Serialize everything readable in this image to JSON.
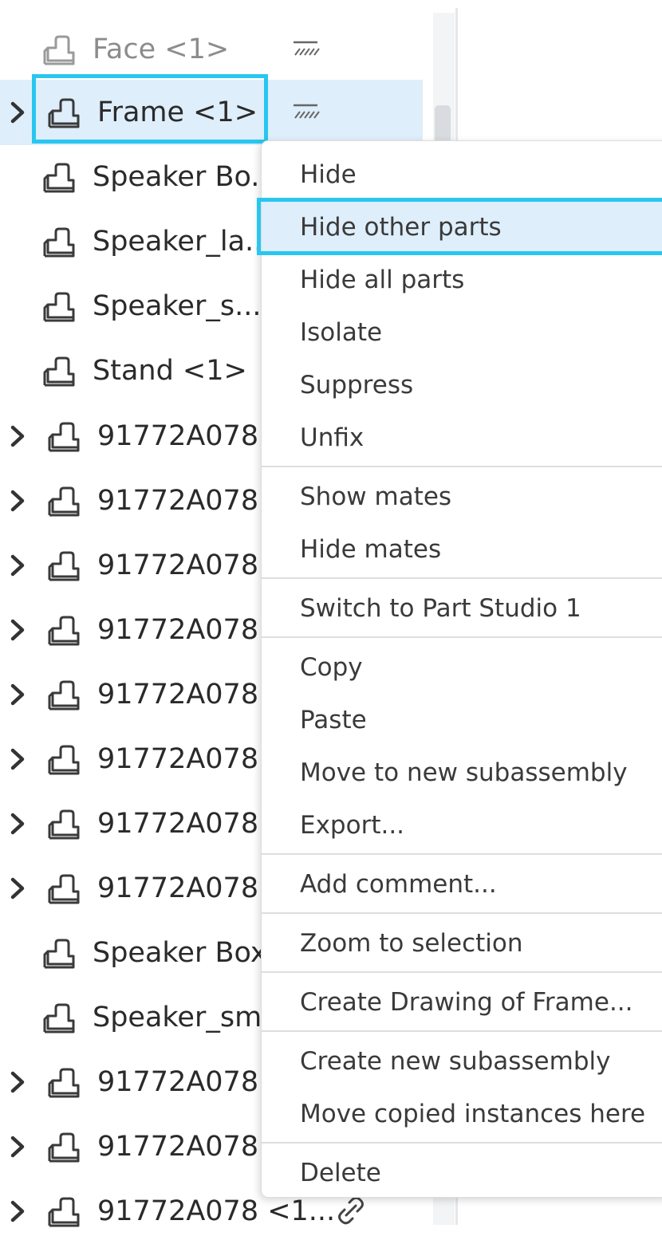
{
  "tree": {
    "rows": [
      {
        "label": "Face <1>"
      },
      {
        "label": "Frame <1>"
      },
      {
        "label": "Speaker Bo..."
      },
      {
        "label": "Speaker_la..."
      },
      {
        "label": "Speaker_s..."
      },
      {
        "label": "Stand <1>"
      },
      {
        "label": "91772A078"
      },
      {
        "label": "91772A078"
      },
      {
        "label": "91772A078"
      },
      {
        "label": "91772A078"
      },
      {
        "label": "91772A078"
      },
      {
        "label": "91772A078"
      },
      {
        "label": "91772A078"
      },
      {
        "label": "91772A078"
      },
      {
        "label": "Speaker Box"
      },
      {
        "label": "Speaker_sm"
      },
      {
        "label": "91772A078"
      },
      {
        "label": "91772A078"
      },
      {
        "label": "91772A078 <1..."
      }
    ]
  },
  "context_menu": {
    "items": [
      {
        "label": "Hide"
      },
      {
        "label": "Hide other parts"
      },
      {
        "label": "Hide all parts"
      },
      {
        "label": "Isolate"
      },
      {
        "label": "Suppress"
      },
      {
        "label": "Unfix"
      },
      {
        "label": "Show mates"
      },
      {
        "label": "Hide mates"
      },
      {
        "label": "Switch to Part Studio 1"
      },
      {
        "label": "Copy"
      },
      {
        "label": "Paste"
      },
      {
        "label": "Move to new subassembly"
      },
      {
        "label": "Export..."
      },
      {
        "label": "Add comment..."
      },
      {
        "label": "Zoom to selection"
      },
      {
        "label": "Create Drawing of Frame..."
      },
      {
        "label": "Create new subassembly"
      },
      {
        "label": "Move copied instances here"
      },
      {
        "label": "Delete"
      }
    ]
  },
  "colors": {
    "highlight_outline": "#29c6f0",
    "selection_fill": "#deeefa"
  }
}
